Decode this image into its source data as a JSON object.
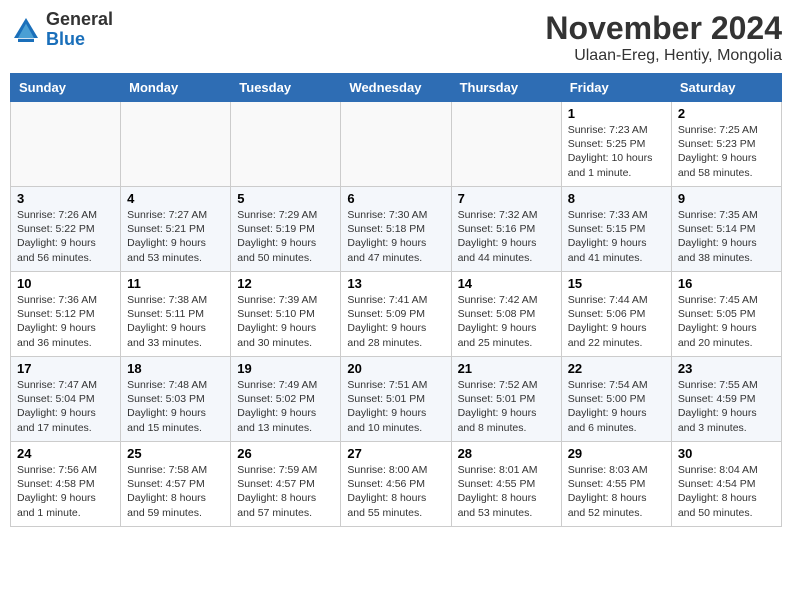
{
  "header": {
    "logo_general": "General",
    "logo_blue": "Blue",
    "month_title": "November 2024",
    "location": "Ulaan-Ereg, Hentiy, Mongolia"
  },
  "weekdays": [
    "Sunday",
    "Monday",
    "Tuesday",
    "Wednesday",
    "Thursday",
    "Friday",
    "Saturday"
  ],
  "weeks": [
    [
      {
        "day": "",
        "info": ""
      },
      {
        "day": "",
        "info": ""
      },
      {
        "day": "",
        "info": ""
      },
      {
        "day": "",
        "info": ""
      },
      {
        "day": "",
        "info": ""
      },
      {
        "day": "1",
        "info": "Sunrise: 7:23 AM\nSunset: 5:25 PM\nDaylight: 10 hours\nand 1 minute."
      },
      {
        "day": "2",
        "info": "Sunrise: 7:25 AM\nSunset: 5:23 PM\nDaylight: 9 hours\nand 58 minutes."
      }
    ],
    [
      {
        "day": "3",
        "info": "Sunrise: 7:26 AM\nSunset: 5:22 PM\nDaylight: 9 hours\nand 56 minutes."
      },
      {
        "day": "4",
        "info": "Sunrise: 7:27 AM\nSunset: 5:21 PM\nDaylight: 9 hours\nand 53 minutes."
      },
      {
        "day": "5",
        "info": "Sunrise: 7:29 AM\nSunset: 5:19 PM\nDaylight: 9 hours\nand 50 minutes."
      },
      {
        "day": "6",
        "info": "Sunrise: 7:30 AM\nSunset: 5:18 PM\nDaylight: 9 hours\nand 47 minutes."
      },
      {
        "day": "7",
        "info": "Sunrise: 7:32 AM\nSunset: 5:16 PM\nDaylight: 9 hours\nand 44 minutes."
      },
      {
        "day": "8",
        "info": "Sunrise: 7:33 AM\nSunset: 5:15 PM\nDaylight: 9 hours\nand 41 minutes."
      },
      {
        "day": "9",
        "info": "Sunrise: 7:35 AM\nSunset: 5:14 PM\nDaylight: 9 hours\nand 38 minutes."
      }
    ],
    [
      {
        "day": "10",
        "info": "Sunrise: 7:36 AM\nSunset: 5:12 PM\nDaylight: 9 hours\nand 36 minutes."
      },
      {
        "day": "11",
        "info": "Sunrise: 7:38 AM\nSunset: 5:11 PM\nDaylight: 9 hours\nand 33 minutes."
      },
      {
        "day": "12",
        "info": "Sunrise: 7:39 AM\nSunset: 5:10 PM\nDaylight: 9 hours\nand 30 minutes."
      },
      {
        "day": "13",
        "info": "Sunrise: 7:41 AM\nSunset: 5:09 PM\nDaylight: 9 hours\nand 28 minutes."
      },
      {
        "day": "14",
        "info": "Sunrise: 7:42 AM\nSunset: 5:08 PM\nDaylight: 9 hours\nand 25 minutes."
      },
      {
        "day": "15",
        "info": "Sunrise: 7:44 AM\nSunset: 5:06 PM\nDaylight: 9 hours\nand 22 minutes."
      },
      {
        "day": "16",
        "info": "Sunrise: 7:45 AM\nSunset: 5:05 PM\nDaylight: 9 hours\nand 20 minutes."
      }
    ],
    [
      {
        "day": "17",
        "info": "Sunrise: 7:47 AM\nSunset: 5:04 PM\nDaylight: 9 hours\nand 17 minutes."
      },
      {
        "day": "18",
        "info": "Sunrise: 7:48 AM\nSunset: 5:03 PM\nDaylight: 9 hours\nand 15 minutes."
      },
      {
        "day": "19",
        "info": "Sunrise: 7:49 AM\nSunset: 5:02 PM\nDaylight: 9 hours\nand 13 minutes."
      },
      {
        "day": "20",
        "info": "Sunrise: 7:51 AM\nSunset: 5:01 PM\nDaylight: 9 hours\nand 10 minutes."
      },
      {
        "day": "21",
        "info": "Sunrise: 7:52 AM\nSunset: 5:01 PM\nDaylight: 9 hours\nand 8 minutes."
      },
      {
        "day": "22",
        "info": "Sunrise: 7:54 AM\nSunset: 5:00 PM\nDaylight: 9 hours\nand 6 minutes."
      },
      {
        "day": "23",
        "info": "Sunrise: 7:55 AM\nSunset: 4:59 PM\nDaylight: 9 hours\nand 3 minutes."
      }
    ],
    [
      {
        "day": "24",
        "info": "Sunrise: 7:56 AM\nSunset: 4:58 PM\nDaylight: 9 hours\nand 1 minute."
      },
      {
        "day": "25",
        "info": "Sunrise: 7:58 AM\nSunset: 4:57 PM\nDaylight: 8 hours\nand 59 minutes."
      },
      {
        "day": "26",
        "info": "Sunrise: 7:59 AM\nSunset: 4:57 PM\nDaylight: 8 hours\nand 57 minutes."
      },
      {
        "day": "27",
        "info": "Sunrise: 8:00 AM\nSunset: 4:56 PM\nDaylight: 8 hours\nand 55 minutes."
      },
      {
        "day": "28",
        "info": "Sunrise: 8:01 AM\nSunset: 4:55 PM\nDaylight: 8 hours\nand 53 minutes."
      },
      {
        "day": "29",
        "info": "Sunrise: 8:03 AM\nSunset: 4:55 PM\nDaylight: 8 hours\nand 52 minutes."
      },
      {
        "day": "30",
        "info": "Sunrise: 8:04 AM\nSunset: 4:54 PM\nDaylight: 8 hours\nand 50 minutes."
      }
    ]
  ]
}
